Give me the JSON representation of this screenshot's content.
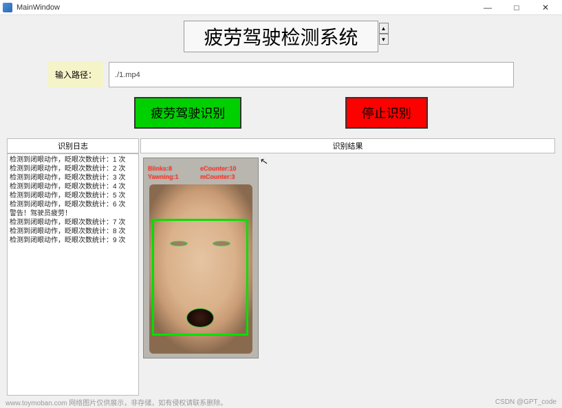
{
  "window": {
    "title": "MainWindow",
    "controls": {
      "min": "—",
      "max": "□",
      "close": "✕"
    }
  },
  "app_title": "疲劳驾驶检测系统",
  "input": {
    "label": "输入路径：",
    "value": "./1.mp4"
  },
  "buttons": {
    "recognize": "疲劳驾驶识别",
    "stop": "停止识别"
  },
  "tabs": {
    "log": "识别日志",
    "result": "识别结果"
  },
  "log_lines": [
    "检测到闭眼动作，眨眼次数统计：1 次",
    "检测到闭眼动作，眨眼次数统计：2 次",
    "检测到闭眼动作，眨眼次数统计：3 次",
    "检测到闭眼动作，眨眼次数统计：4 次",
    "检测到闭眼动作，眨眼次数统计：5 次",
    "检测到闭眼动作，眨眼次数统计：6 次",
    "警告！驾驶员疲劳！",
    "检测到闭眼动作，眨眼次数统计：7 次",
    "检测到闭眼动作，眨眼次数统计：8 次",
    "检测到闭眼动作，眨眼次数统计：9 次"
  ],
  "overlay": {
    "blinks": "Blinks:8",
    "yawning": "Yawning:1",
    "ecounter": "eCounter:10",
    "mcounter": "mCounter:3"
  },
  "footer": {
    "left": "www.toymoban.com  网络图片仅供展示，非存储，如有侵权请联系删除。",
    "right": "CSDN @GPT_code"
  }
}
